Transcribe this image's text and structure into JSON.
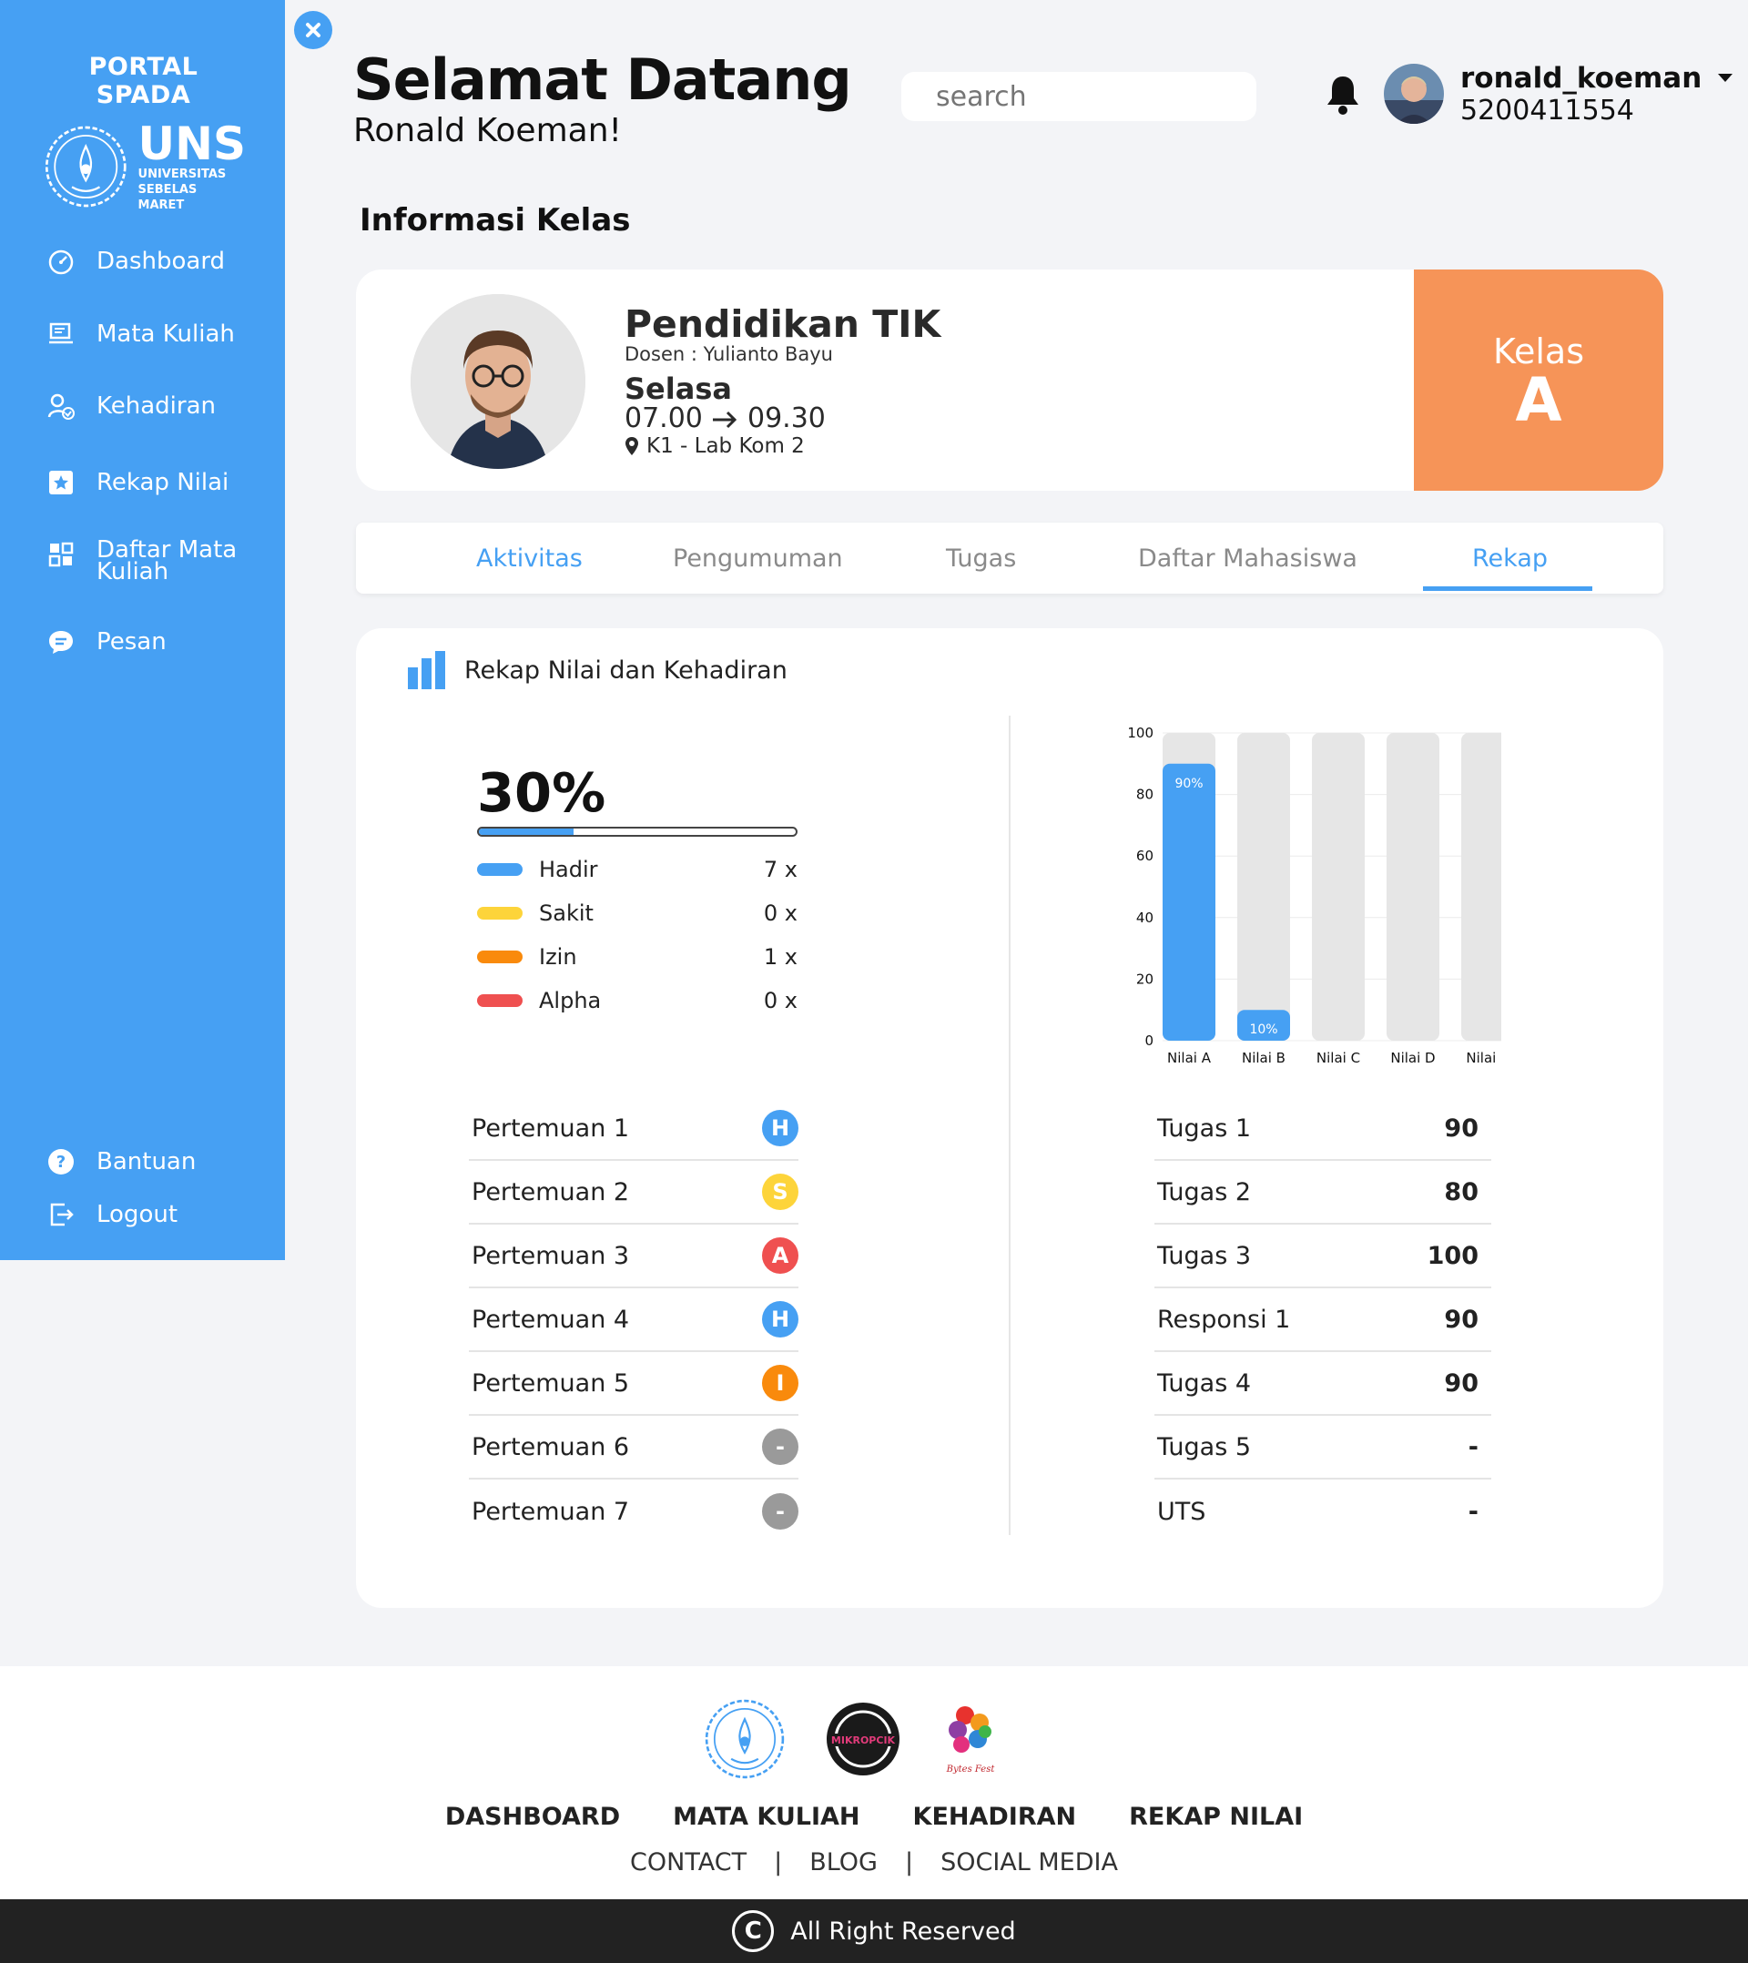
{
  "sidebar": {
    "brand_title": "PORTAL SPADA",
    "brand_short": "UNS",
    "brand_sub_1": "UNIVERSITAS",
    "brand_sub_2": "SEBELAS MARET",
    "items": [
      {
        "label": "Dashboard",
        "icon": "gauge-icon"
      },
      {
        "label": "Mata Kuliah",
        "icon": "laptop-icon"
      },
      {
        "label": "Kehadiran",
        "icon": "user-check-icon"
      },
      {
        "label": "Rekap Nilai",
        "icon": "star-icon"
      },
      {
        "label": "Daftar Mata Kuliah",
        "icon": "grid-icon"
      },
      {
        "label": "Pesan",
        "icon": "chat-icon"
      }
    ],
    "bottom": [
      {
        "label": "Bantuan",
        "icon": "help-icon"
      },
      {
        "label": "Logout",
        "icon": "logout-icon"
      }
    ]
  },
  "header": {
    "title": "Selamat Datang",
    "subtitle": "Ronald Koeman!",
    "search_placeholder": "search",
    "username": "ronald_koeman",
    "user_id": "5200411554"
  },
  "section_title": "Informasi Kelas",
  "class_card": {
    "name": "Pendidikan TIK",
    "dosen": "Dosen : Yulianto Bayu",
    "day": "Selasa",
    "time_start": "07.00",
    "time_end": "09.30",
    "room": "K1 - Lab Kom 2",
    "kelas_label": "Kelas",
    "kelas_value": "A"
  },
  "tabs": [
    {
      "label": "Aktivitas",
      "active": false
    },
    {
      "label": "Pengumuman",
      "active": false
    },
    {
      "label": "Tugas",
      "active": false
    },
    {
      "label": "Daftar Mahasiswa",
      "active": false
    },
    {
      "label": "Rekap",
      "active": true
    }
  ],
  "rekap": {
    "title": "Rekap Nilai dan Kehadiran",
    "attendance_percent": "30%",
    "attendance_fraction": 0.3,
    "legend": [
      {
        "label": "Hadir",
        "count": "7 x",
        "color": "#46a0f3"
      },
      {
        "label": "Sakit",
        "count": "0 x",
        "color": "#fdd43a"
      },
      {
        "label": "Izin",
        "count": "1 x",
        "color": "#f98a0c"
      },
      {
        "label": "Alpha",
        "count": "0 x",
        "color": "#ef5050"
      }
    ],
    "meetings": [
      {
        "label": "Pertemuan 1",
        "status": "H",
        "color": "#46a0f3"
      },
      {
        "label": "Pertemuan 2",
        "status": "S",
        "color": "#fdd43a"
      },
      {
        "label": "Pertemuan 3",
        "status": "A",
        "color": "#ef5050"
      },
      {
        "label": "Pertemuan 4",
        "status": "H",
        "color": "#46a0f3"
      },
      {
        "label": "Pertemuan 5",
        "status": "I",
        "color": "#f98a0c"
      },
      {
        "label": "Pertemuan 6",
        "status": "-",
        "color": "#9a9a9a"
      },
      {
        "label": "Pertemuan 7",
        "status": "-",
        "color": "#9a9a9a"
      }
    ],
    "grades": [
      {
        "label": "Tugas 1",
        "value": "90"
      },
      {
        "label": "Tugas 2",
        "value": "80"
      },
      {
        "label": "Tugas 3",
        "value": "100"
      },
      {
        "label": "Responsi 1",
        "value": "90"
      },
      {
        "label": "Tugas 4",
        "value": "90"
      },
      {
        "label": "Tugas 5",
        "value": "-"
      },
      {
        "label": "UTS",
        "value": "-"
      }
    ]
  },
  "chart_data": {
    "type": "bar",
    "categories": [
      "Nilai A",
      "Nilai B",
      "Nilai C",
      "Nilai D",
      "Nilai E"
    ],
    "values": [
      90,
      10,
      0,
      0,
      0
    ],
    "data_labels": [
      "90%",
      "10%",
      "",
      "",
      ""
    ],
    "yticks": [
      0,
      20,
      40,
      60,
      80,
      100
    ],
    "ylim": [
      0,
      100
    ],
    "bar_color": "#46a0f3",
    "track_color": "#e6e6e6"
  },
  "footer": {
    "nav": [
      "DASHBOARD",
      "MATA KULIAH",
      "KEHADIRAN",
      "REKAP NILAI"
    ],
    "links": [
      "CONTACT",
      "BLOG",
      "SOCIAL MEDIA"
    ],
    "logo_text_2": "MIKROPCIK",
    "logo_text_3": "Bytes Fest",
    "copyright": "All Right Reserved",
    "copyright_symbol": "C"
  }
}
